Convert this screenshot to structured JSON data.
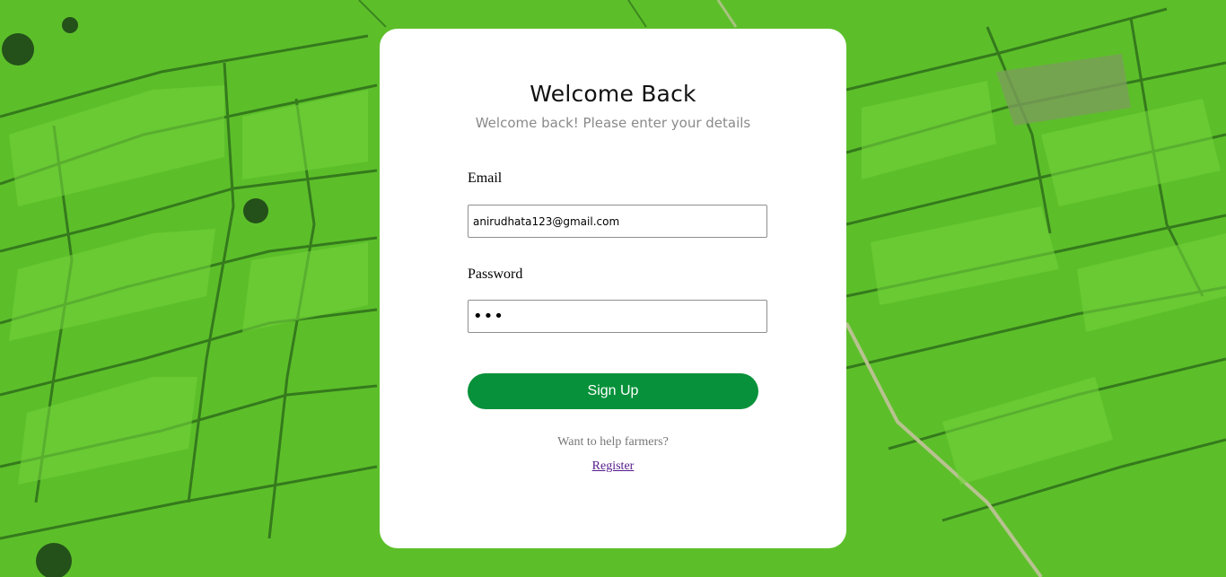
{
  "background": {
    "image": "aerial-rice-fields",
    "color": "#5cbf2a"
  },
  "login": {
    "title": "Welcome Back",
    "subtitle": "Welcome back! Please enter your details",
    "email_label": "Email",
    "email_value": "anirudhata123@gmail.com",
    "password_label": "Password",
    "password_value": "abc",
    "submit_label": "Sign Up",
    "help_text": "Want to help farmers?",
    "register_link": "Register",
    "accent_color": "#07913a"
  }
}
